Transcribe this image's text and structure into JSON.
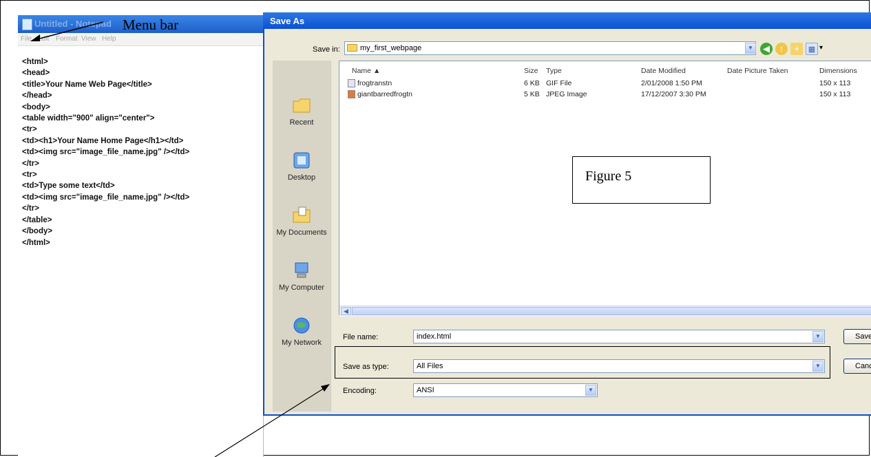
{
  "annotations": {
    "menu_bar_label": "Menu bar",
    "figure_label": "Figure 5"
  },
  "notepad": {
    "title": "Untitled - Notepad",
    "menu": [
      "File",
      "Edit",
      "Format",
      "View",
      "Help"
    ],
    "content": "<html>\n<head>\n<title>Your Name Web Page</title>\n</head>\n<body>\n<table width=\"900\" align=\"center\">\n<tr>\n<td><h1>Your Name Home Page</h1></td>\n<td><img src=\"image_file_name.jpg\" /></td>\n</tr>\n<tr>\n<td>Type some text</td>\n<td><img src=\"image_file_name.jpg\" /></td>\n</tr>\n</table>\n</body>\n</html>"
  },
  "dialog": {
    "title": "Save As",
    "save_in_label": "Save in:",
    "save_in_value": "my_first_webpage",
    "places": [
      "Recent",
      "Desktop",
      "My Documents",
      "My Computer",
      "My Network"
    ],
    "columns": [
      "Name",
      "Size",
      "Type",
      "Date Modified",
      "Date Picture Taken",
      "Dimensions"
    ],
    "files": [
      {
        "name": "frogtranstn",
        "size": "6 KB",
        "type": "GIF File",
        "date_modified": "2/01/2008 1:50 PM",
        "date_picture_taken": "",
        "dimensions": "150 x 113"
      },
      {
        "name": "giantbarredfrogtn",
        "size": "5 KB",
        "type": "JPEG Image",
        "date_modified": "17/12/2007 3:30 PM",
        "date_picture_taken": "",
        "dimensions": "150 x 113"
      }
    ],
    "file_name_label": "File name:",
    "file_name_value": "index.html",
    "save_as_type_label": "Save as type:",
    "save_as_type_value": "All Files",
    "encoding_label": "Encoding:",
    "encoding_value": "ANSI",
    "save_button": "Save",
    "cancel_button": "Cancel"
  },
  "colors": {
    "title_bar": "#1e5fc9",
    "dialog_bg": "#ece9d8",
    "places_bar": "#d8d5c6"
  }
}
